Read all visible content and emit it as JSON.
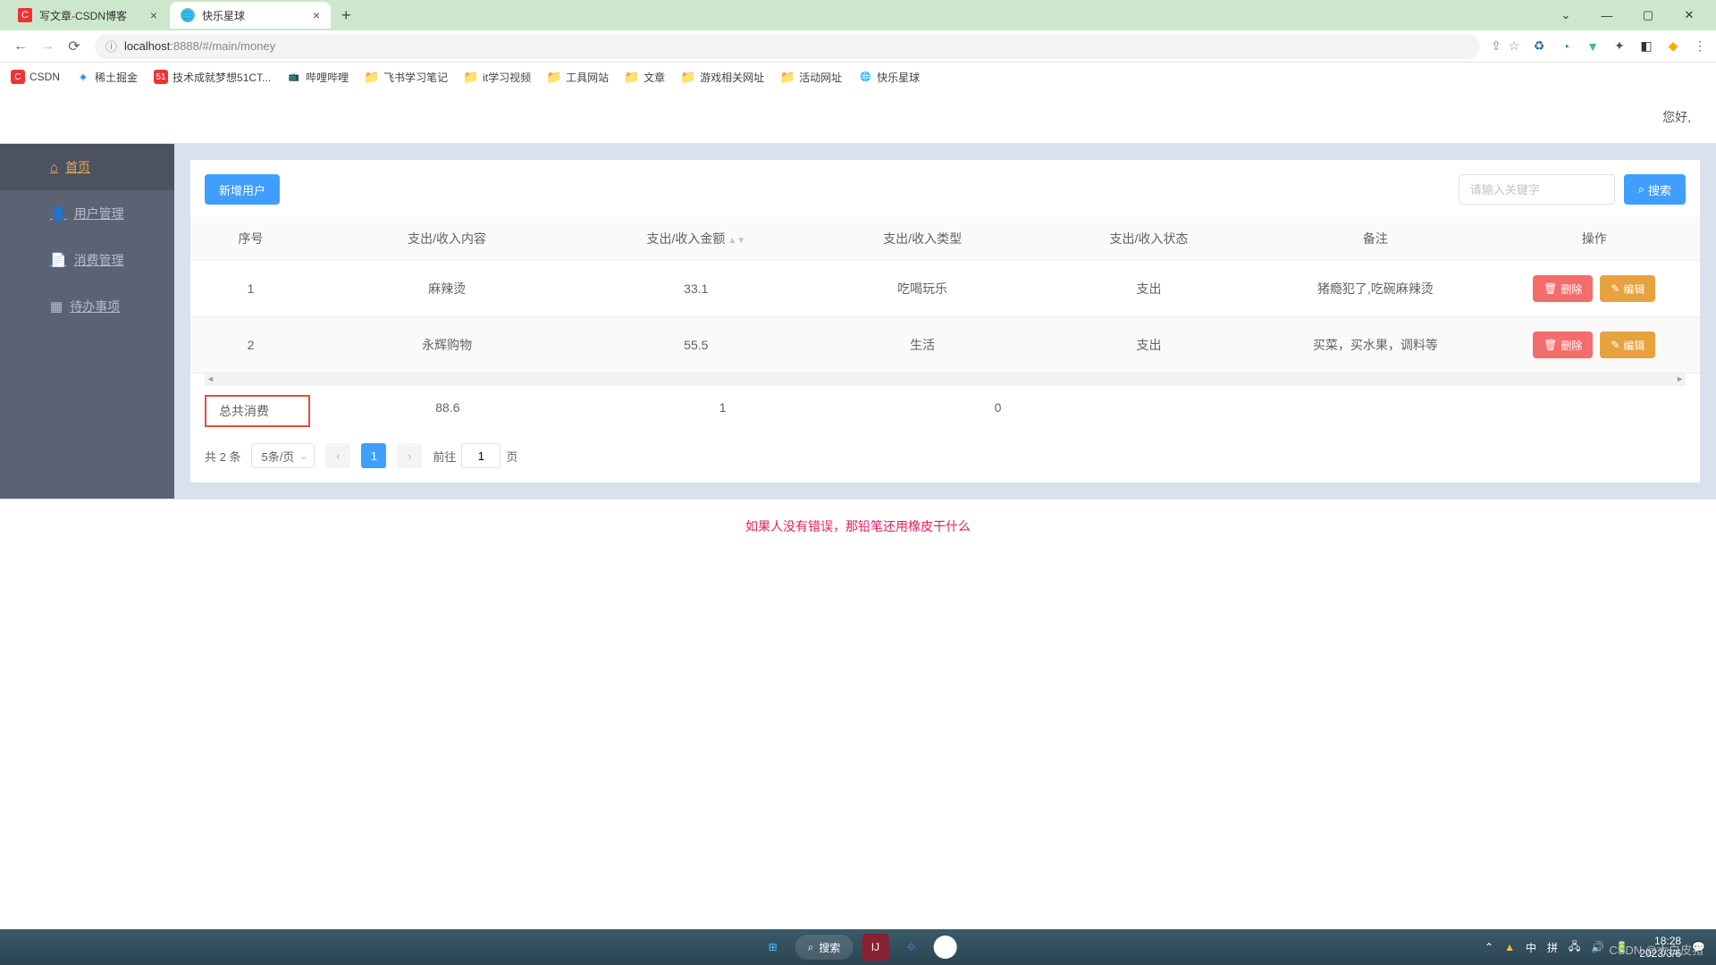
{
  "browser": {
    "tabs": [
      {
        "title": "写文章-CSDN博客",
        "active": false
      },
      {
        "title": "快乐星球",
        "active": true
      }
    ],
    "url_host": "localhost",
    "url_port": ":8888",
    "url_path": "/#/main/money",
    "bookmarks": [
      {
        "label": "CSDN",
        "iconClass": "csdn"
      },
      {
        "label": "稀土掘金",
        "iconClass": "juejin"
      },
      {
        "label": "技术成就梦想51CT...",
        "iconClass": "cto"
      },
      {
        "label": "哔哩哔哩",
        "iconClass": "bili"
      },
      {
        "label": "飞书学习笔记",
        "iconClass": "folder"
      },
      {
        "label": "it学习视频",
        "iconClass": "folder"
      },
      {
        "label": "工具网站",
        "iconClass": "folder"
      },
      {
        "label": "文章",
        "iconClass": "folder"
      },
      {
        "label": "游戏相关网址",
        "iconClass": "folder"
      },
      {
        "label": "活动网址",
        "iconClass": "folder"
      },
      {
        "label": "快乐星球",
        "iconClass": "site"
      }
    ]
  },
  "app": {
    "greeting": "您好,",
    "sidebar": [
      {
        "label": "首页",
        "icon": "⌂"
      },
      {
        "label": "用户管理",
        "icon": "👤"
      },
      {
        "label": "消费管理",
        "icon": "📄"
      },
      {
        "label": "待办事项",
        "icon": "▦"
      }
    ],
    "toolbar": {
      "add_label": "新增用户",
      "search_placeholder": "请输入关键字",
      "search_btn": "搜索"
    },
    "table": {
      "headers": {
        "index": "序号",
        "content": "支出/收入内容",
        "amount": "支出/收入金额",
        "type": "支出/收入类型",
        "status": "支出/收入状态",
        "note": "备注",
        "ops": "操作"
      },
      "rows": [
        {
          "index": "1",
          "content": "麻辣烫",
          "amount": "33.1",
          "type": "吃喝玩乐",
          "status": "支出",
          "note": "猪瘾犯了,吃碗麻辣烫"
        },
        {
          "index": "2",
          "content": "永辉购物",
          "amount": "55.5",
          "type": "生活",
          "status": "支出",
          "note": "买菜，买水果，调料等"
        }
      ],
      "ops": {
        "delete": "删除",
        "edit": "编辑"
      },
      "summary": {
        "label": "总共消费",
        "amount": "88.6",
        "v1": "1",
        "v2": "0"
      }
    },
    "pager": {
      "total": "共 2 条",
      "page_size": "5条/页",
      "current": "1",
      "jump_prefix": "前往",
      "jump_value": "1",
      "jump_suffix": "页"
    },
    "footer_quote": "如果人没有错误，那铅笔还用橡皮干什么"
  },
  "taskbar": {
    "search_label": "搜索",
    "ime": "中",
    "ime2": "拼",
    "time": "18:28",
    "date": "2023/3/6"
  },
  "watermark": "CSDN @大白皮猪"
}
